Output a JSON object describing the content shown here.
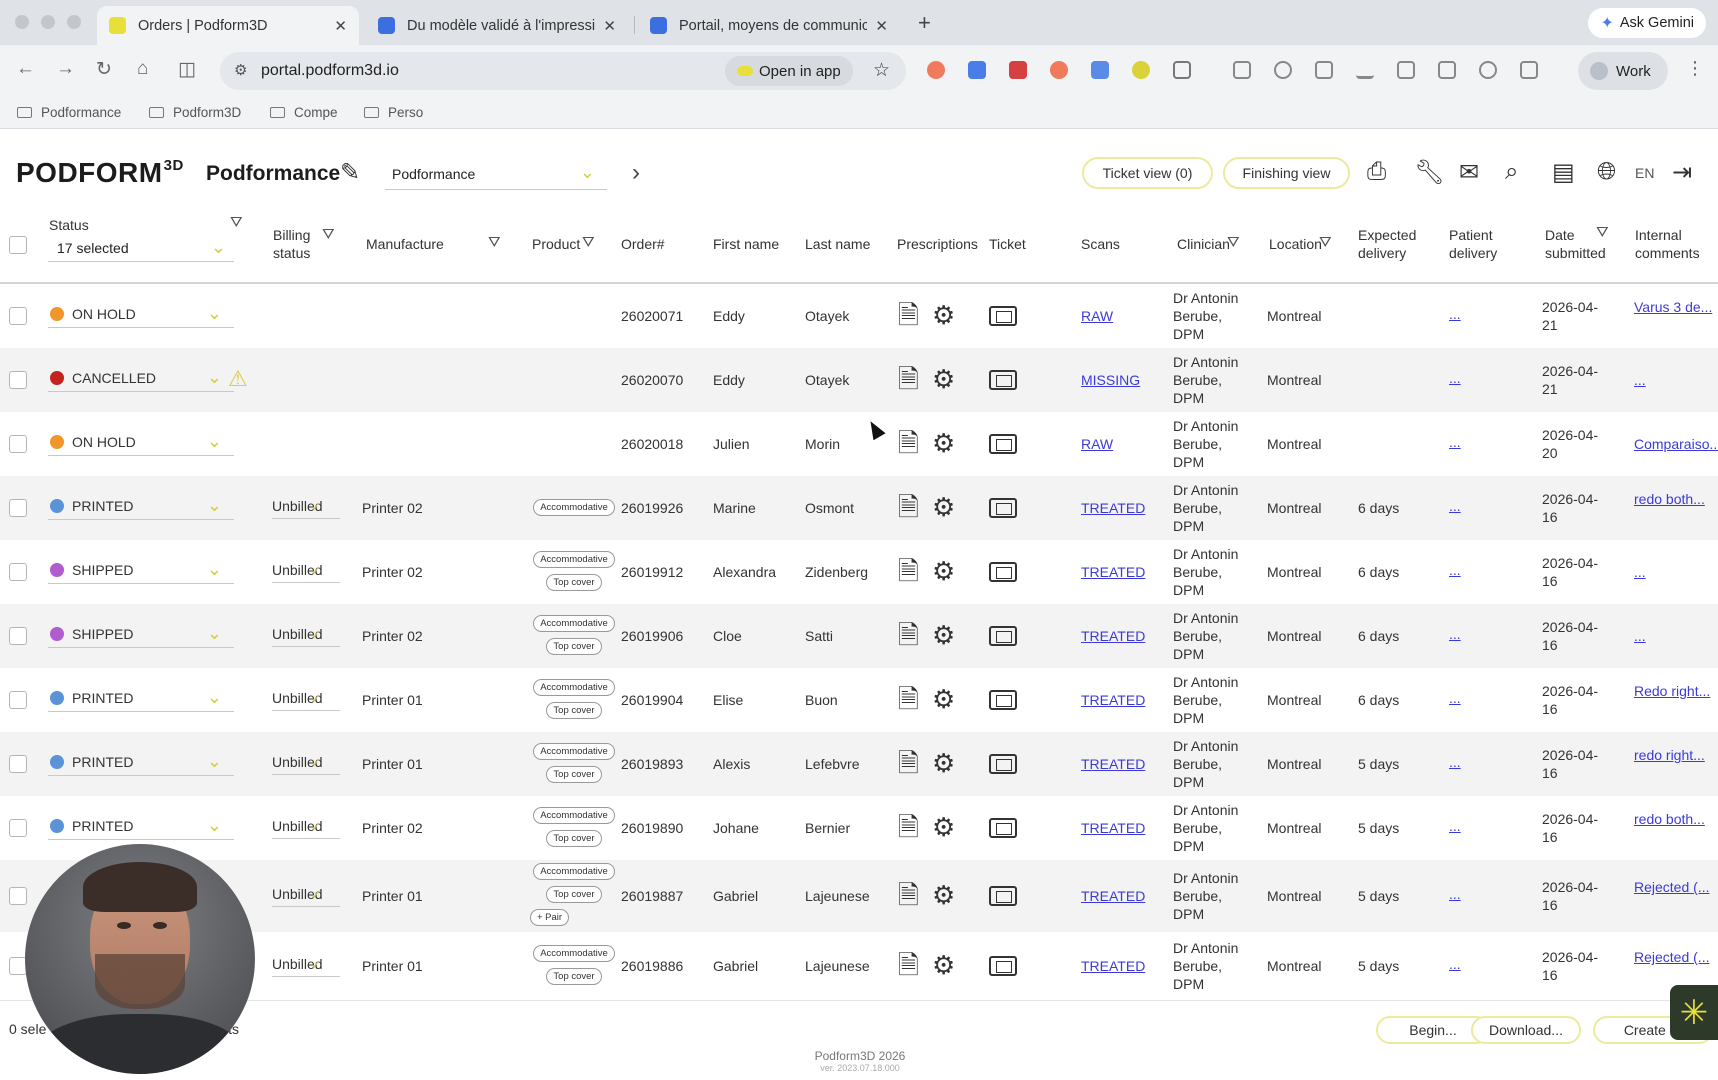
{
  "browser": {
    "tabs": [
      {
        "title": "Orders | Podform3D",
        "active": true,
        "favicon_color": "#e8e03a"
      },
      {
        "title": "Du modèle validé à l'impressi",
        "active": false,
        "favicon_color": "#3b6fe0"
      },
      {
        "title": "Portail, moyens de communic",
        "active": false,
        "favicon_color": "#3b6fe0"
      }
    ],
    "gemini_label": "Ask Gemini",
    "url": "portal.podform3d.io",
    "open_in_app_label": "Open in app",
    "profile_label": "Work",
    "bookmarks": [
      "Podformance",
      "Podform3D",
      "Compe",
      "Perso"
    ]
  },
  "header": {
    "logo": "PODFORM",
    "logo_sup": "3D",
    "org_name": "Podformance",
    "org_select_value": "Podformance",
    "ticket_view_label": "Ticket view (0)",
    "finishing_view_label": "Finishing view",
    "language": "EN"
  },
  "columns": {
    "status": "Status",
    "status_filter_value": "17 selected",
    "billing_line1": "Billing",
    "billing_line2": "status",
    "manufacture": "Manufacture",
    "product": "Product",
    "order": "Order#",
    "first_name": "First name",
    "last_name": "Last name",
    "prescriptions": "Prescriptions",
    "ticket": "Ticket",
    "scans": "Scans",
    "clinician": "Clinician",
    "location": "Location",
    "expected_line1": "Expected",
    "expected_line2": "delivery",
    "patient_line1": "Patient",
    "patient_line2": "delivery",
    "date_line1": "Date",
    "date_line2": "submitted",
    "internal_line1": "Internal",
    "internal_line2": "comments"
  },
  "status_colors": {
    "ON HOLD": "#f0962a",
    "CANCELLED": "#c4221c",
    "PRINTED": "#5a93d6",
    "SHIPPED": "#b05ccf"
  },
  "rows": [
    {
      "status": "ON HOLD",
      "warning": false,
      "billing": "",
      "manufacture": "",
      "tags": [],
      "order": "26020071",
      "first": "Eddy",
      "last": "Otayek",
      "scan": "RAW",
      "clin1": "Dr Antonin",
      "clin2": "Berube,",
      "clin3": "DPM",
      "location": "Montreal",
      "expected": "",
      "patient": "...",
      "date1": "2026-04-",
      "date2": "21",
      "comment": "Varus 3 de..."
    },
    {
      "status": "CANCELLED",
      "warning": true,
      "billing": "",
      "manufacture": "",
      "tags": [],
      "order": "26020070",
      "first": "Eddy",
      "last": "Otayek",
      "scan": "MISSING",
      "clin1": "Dr Antonin",
      "clin2": "Berube,",
      "clin3": "DPM",
      "location": "Montreal",
      "expected": "",
      "patient": "...",
      "date1": "2026-04-",
      "date2": "21",
      "comment": "..."
    },
    {
      "status": "ON HOLD",
      "warning": false,
      "billing": "",
      "manufacture": "",
      "tags": [],
      "order": "26020018",
      "first": "Julien",
      "last": "Morin",
      "scan": "RAW",
      "clin1": "Dr Antonin",
      "clin2": "Berube,",
      "clin3": "DPM",
      "location": "Montreal",
      "expected": "",
      "patient": "...",
      "date1": "2026-04-",
      "date2": "20",
      "comment": "Comparaiso..."
    },
    {
      "status": "PRINTED",
      "warning": false,
      "billing": "Unbilled",
      "manufacture": "Printer 02",
      "tags": [
        "Accommodative"
      ],
      "order": "26019926",
      "first": "Marine",
      "last": "Osmont",
      "scan": "TREATED",
      "clin1": "Dr Antonin",
      "clin2": "Berube,",
      "clin3": "DPM",
      "location": "Montreal",
      "expected": "6 days",
      "patient": "...",
      "date1": "2026-04-",
      "date2": "16",
      "comment": "redo both..."
    },
    {
      "status": "SHIPPED",
      "warning": false,
      "billing": "Unbilled",
      "manufacture": "Printer 02",
      "tags": [
        "Accommodative",
        "Top cover"
      ],
      "order": "26019912",
      "first": "Alexandra",
      "last": "Zidenberg",
      "scan": "TREATED",
      "clin1": "Dr Antonin",
      "clin2": "Berube,",
      "clin3": "DPM",
      "location": "Montreal",
      "expected": "6 days",
      "patient": "...",
      "date1": "2026-04-",
      "date2": "16",
      "comment": "..."
    },
    {
      "status": "SHIPPED",
      "warning": false,
      "billing": "Unbilled",
      "manufacture": "Printer 02",
      "tags": [
        "Accommodative",
        "Top cover"
      ],
      "order": "26019906",
      "first": "Cloe",
      "last": "Satti",
      "scan": "TREATED",
      "clin1": "Dr Antonin",
      "clin2": "Berube,",
      "clin3": "DPM",
      "location": "Montreal",
      "expected": "6 days",
      "patient": "...",
      "date1": "2026-04-",
      "date2": "16",
      "comment": "..."
    },
    {
      "status": "PRINTED",
      "warning": false,
      "billing": "Unbilled",
      "manufacture": "Printer 01",
      "tags": [
        "Accommodative",
        "Top cover"
      ],
      "order": "26019904",
      "first": "Elise",
      "last": "Buon",
      "scan": "TREATED",
      "clin1": "Dr Antonin",
      "clin2": "Berube,",
      "clin3": "DPM",
      "location": "Montreal",
      "expected": "6 days",
      "patient": "...",
      "date1": "2026-04-",
      "date2": "16",
      "comment": "Redo right..."
    },
    {
      "status": "PRINTED",
      "warning": false,
      "billing": "Unbilled",
      "manufacture": "Printer 01",
      "tags": [
        "Accommodative",
        "Top cover"
      ],
      "order": "26019893",
      "first": "Alexis",
      "last": "Lefebvre",
      "scan": "TREATED",
      "clin1": "Dr Antonin",
      "clin2": "Berube,",
      "clin3": "DPM",
      "location": "Montreal",
      "expected": "5 days",
      "patient": "...",
      "date1": "2026-04-",
      "date2": "16",
      "comment": "redo right..."
    },
    {
      "status": "PRINTED",
      "warning": false,
      "billing": "Unbilled",
      "manufacture": "Printer 02",
      "tags": [
        "Accommodative",
        "Top cover"
      ],
      "order": "26019890",
      "first": "Johane",
      "last": "Bernier",
      "scan": "TREATED",
      "clin1": "Dr Antonin",
      "clin2": "Berube,",
      "clin3": "DPM",
      "location": "Montreal",
      "expected": "5 days",
      "patient": "...",
      "date1": "2026-04-",
      "date2": "16",
      "comment": "redo both..."
    },
    {
      "status": "",
      "warning": false,
      "billing": "Unbilled",
      "manufacture": "Printer 01",
      "tags": [
        "Accommodative",
        "Top cover",
        "+ Pair"
      ],
      "order": "26019887",
      "first": "Gabriel",
      "last": "Lajeunese",
      "scan": "TREATED",
      "clin1": "Dr Antonin",
      "clin2": "Berube,",
      "clin3": "DPM",
      "location": "Montreal",
      "expected": "5 days",
      "patient": "...",
      "date1": "2026-04-",
      "date2": "16",
      "comment": "Rejected (..."
    },
    {
      "status": "",
      "warning": false,
      "billing": "Unbilled",
      "manufacture": "Printer 01",
      "tags": [
        "Accommodative",
        "Top cover"
      ],
      "order": "26019886",
      "first": "Gabriel",
      "last": "Lajeunese",
      "scan": "TREATED",
      "clin1": "Dr Antonin",
      "clin2": "Berube,",
      "clin3": "DPM",
      "location": "Montreal",
      "expected": "5 days",
      "patient": "...",
      "date1": "2026-04-",
      "date2": "16",
      "comment": "Rejected (..."
    }
  ],
  "footer": {
    "selected_count": "0 sele",
    "results": "lts",
    "begin_label": "Begin...",
    "download_label": "Download...",
    "create_label": "Create or",
    "copyright": "Podform3D 2026",
    "version": "ver. 2023.07.18.000"
  }
}
